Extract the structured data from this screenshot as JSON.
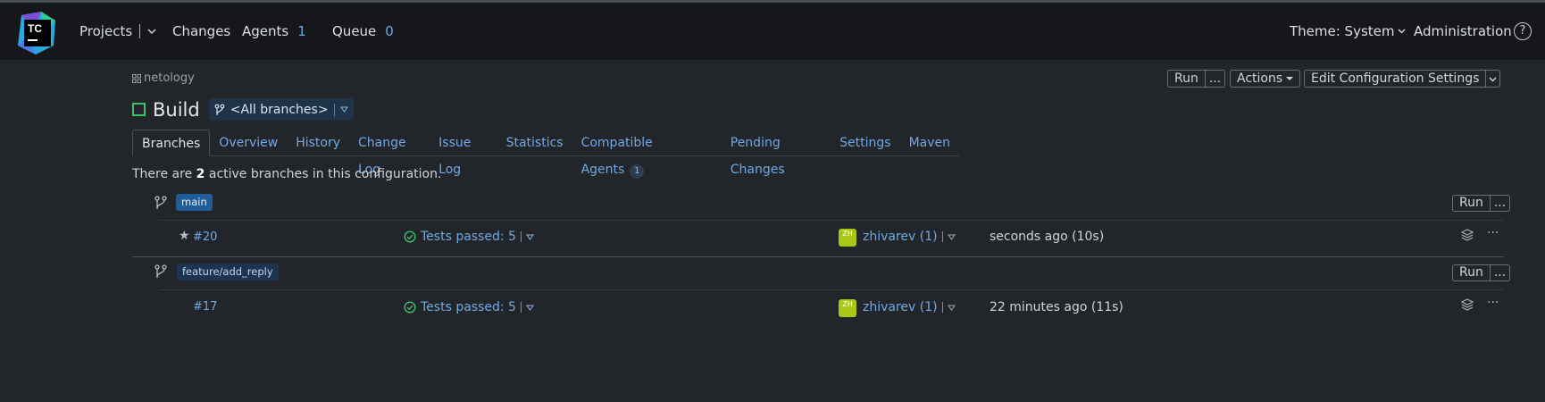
{
  "header": {
    "logo_text": "TC",
    "projects": "Projects",
    "changes": "Changes",
    "agents": "Agents",
    "agents_count": "1",
    "queue": "Queue",
    "queue_count": "0",
    "theme": "Theme: System",
    "administration": "Administration",
    "help": "?"
  },
  "breadcrumb": {
    "project": "netology"
  },
  "toolbar": {
    "run": "Run",
    "more": "...",
    "actions": "Actions",
    "edit_settings": "Edit Configuration Settings"
  },
  "build": {
    "title": "Build",
    "branch_filter": "<All branches>"
  },
  "tabs": [
    {
      "label": "Branches"
    },
    {
      "label": "Overview"
    },
    {
      "label": "History"
    },
    {
      "label": "Change Log"
    },
    {
      "label": "Issue Log"
    },
    {
      "label": "Statistics"
    },
    {
      "label": "Compatible Agents",
      "badge": "1"
    },
    {
      "label": "Pending Changes"
    },
    {
      "label": "Settings"
    },
    {
      "label": "Maven"
    }
  ],
  "summary": {
    "prefix": "There are",
    "count": "2",
    "suffix": "active branches in this configuration."
  },
  "branches": [
    {
      "name": "main",
      "run": "Run",
      "more": "...",
      "build": {
        "number": "#20",
        "tests": "Tests passed: 5",
        "avatar": "ZH",
        "user": "zhivarev (1)",
        "time": "seconds ago (10s)"
      }
    },
    {
      "name": "feature/add_reply",
      "run": "Run",
      "more": "...",
      "build": {
        "number": "#17",
        "tests": "Tests passed: 5",
        "avatar": "ZH",
        "user": "zhivarev (1)",
        "time": "22 minutes ago (11s)"
      }
    }
  ],
  "row_more": "···"
}
